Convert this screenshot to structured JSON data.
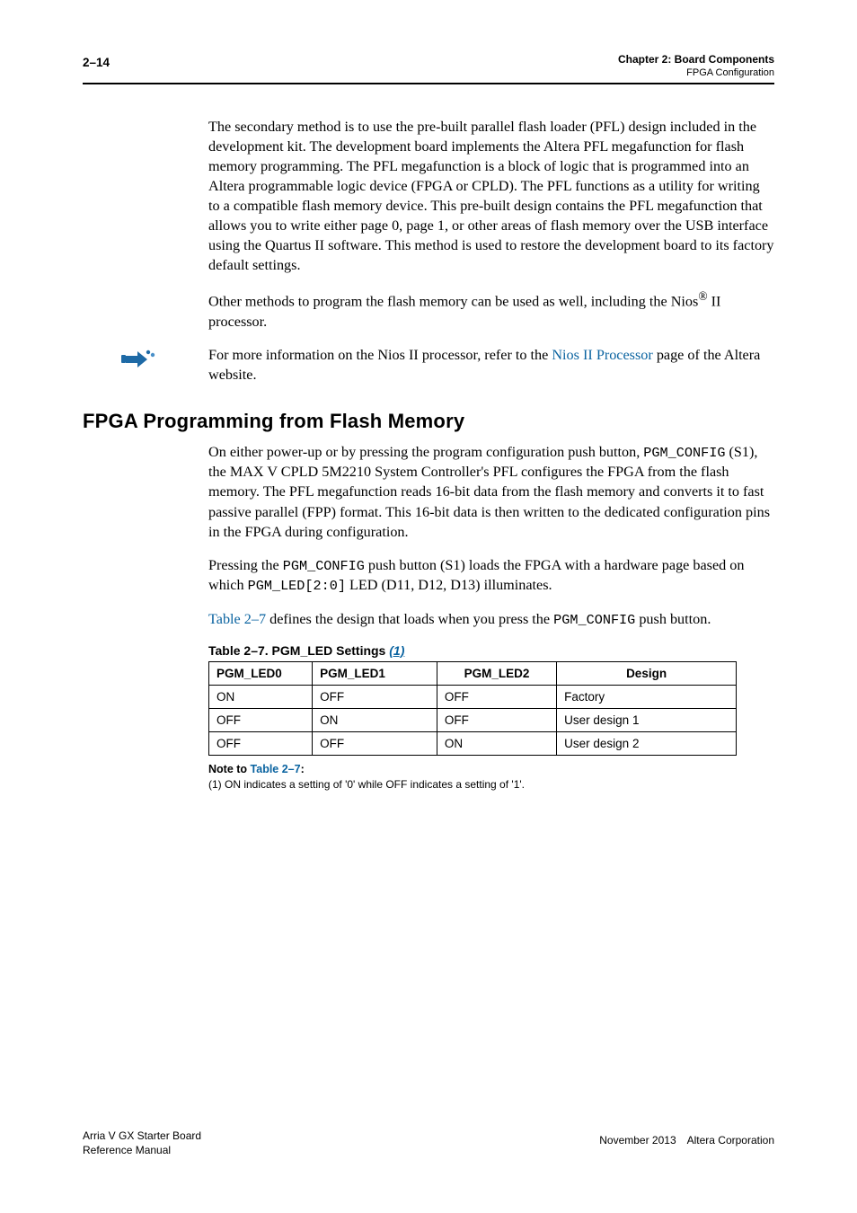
{
  "header": {
    "page_num": "2–14",
    "chapter_line": "Chapter 2: Board Components",
    "sub_line": "FPGA Configuration"
  },
  "para1": "The secondary method is to use the pre-built parallel flash loader (PFL) design included in the development kit. The development board implements the Altera PFL megafunction for flash memory programming. The PFL megafunction is a block of logic that is programmed into an Altera programmable logic device (FPGA or CPLD). The PFL functions as a utility for writing to a compatible flash memory device. This pre-built design contains the PFL megafunction that allows you to write either page 0, page 1, or other areas of flash memory over the USB interface using the Quartus II software. This method is used to restore the development board to its factory default settings.",
  "para2_pre": "Other methods to program the flash memory can be used as well, including the Nios",
  "para2_post": " II processor.",
  "para3_pre": "For more information on the Nios II processor, refer to the ",
  "para3_link": "Nios II Processor",
  "para3_post": " page of the Altera website.",
  "section_heading": "FPGA Programming from Flash Memory",
  "para4_a": "On either power-up or by pressing the program configuration push button, ",
  "para4_code1": "PGM_CONFIG",
  "para4_b": " (S1), the MAX V CPLD 5M2210 System Controller's PFL configures the FPGA from the flash memory. The PFL megafunction reads 16-bit data from the flash memory and converts it to fast passive parallel (FPP) format. This 16-bit data is then written to the dedicated configuration pins in the FPGA during configuration.",
  "para5_a": "Pressing the ",
  "para5_code1": "PGM_CONFIG",
  "para5_b": " push button (S1) loads the FPGA with a hardware page based on which ",
  "para5_code2": "PGM_LED[2:0]",
  "para5_c": " LED (D11, D12, D13) illuminates.",
  "para6_link": "Table 2–7",
  "para6_a": " defines the design that loads when you press the ",
  "para6_code": "PGM_CONFIG",
  "para6_b": " push button.",
  "table": {
    "caption_a": "Table 2–7. PGM_LED Settings ",
    "caption_sup": "(1)",
    "headers": [
      "PGM_LED0",
      "PGM_LED1",
      "PGM_LED2",
      "Design"
    ],
    "rows": [
      [
        "ON",
        "OFF",
        "OFF",
        "Factory"
      ],
      [
        "OFF",
        "ON",
        "OFF",
        "User design 1"
      ],
      [
        "OFF",
        "OFF",
        "ON",
        "User design 2"
      ]
    ]
  },
  "note_head_a": "Note to ",
  "note_head_link": "Table 2–7",
  "note_head_b": ":",
  "note_body": "(1) ON indicates a setting of '0' while OFF indicates a setting of '1'.",
  "footer": {
    "left_line1": "Arria V GX Starter Board",
    "left_line2": "Reference Manual",
    "right": "November 2013 Altera Corporation"
  }
}
